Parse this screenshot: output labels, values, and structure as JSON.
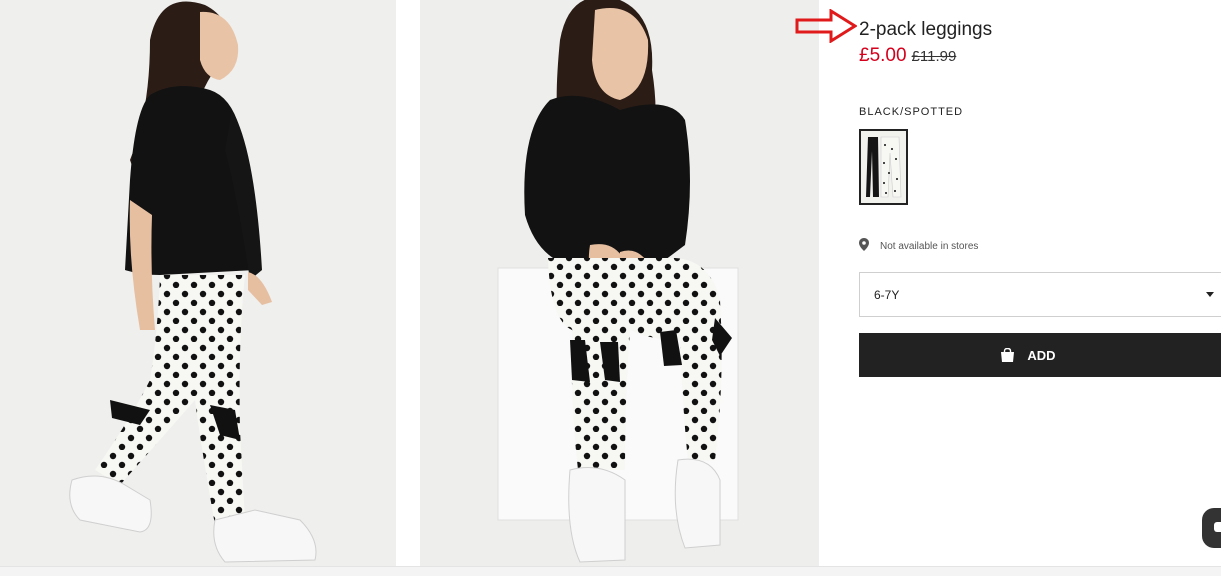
{
  "product": {
    "title": "2-pack leggings",
    "price_now": "£5.00",
    "price_was": "£11.99",
    "color_label": "BLACK/SPOTTED",
    "store_text": "Not available in stores",
    "size_value": "6-7Y",
    "add_label": "ADD"
  },
  "icons": {
    "pin": "location-pin-icon",
    "bag": "shopping-bag-icon",
    "caret": "chevron-down-icon",
    "arrow": "annotation-arrow-icon"
  },
  "colors": {
    "price_red": "#d6001c",
    "button_bg": "#222222",
    "annotation_red": "#e01a1a"
  }
}
